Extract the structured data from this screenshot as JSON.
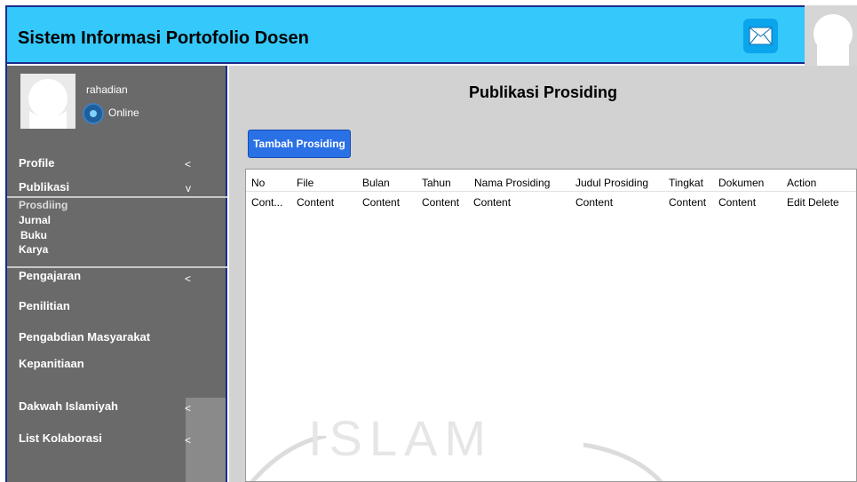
{
  "header": {
    "title": "Sistem Informasi Portofolio Dosen"
  },
  "user": {
    "name": "rahadian",
    "status": "Online"
  },
  "sidebar": {
    "profile": {
      "label": "Profile",
      "arrow": "<"
    },
    "publikasi": {
      "label": "Publikasi",
      "arrow": "v"
    },
    "sub": [
      "Prosdiing",
      "Jurnal",
      "Buku",
      "Karya"
    ],
    "pengajaran": {
      "label": "Pengajaran",
      "arrow": "<"
    },
    "penilitian": {
      "label": "Penilitian"
    },
    "pengabdian": {
      "label": "Pengabdian Masyarakat"
    },
    "kepanitiaan": {
      "label": "Kepanitiaan"
    },
    "dakwah": {
      "label": "Dakwah Islamiyah",
      "arrow": "<"
    },
    "kolaborasi": {
      "label": "List Kolaborasi",
      "arrow": "<"
    }
  },
  "main": {
    "title": "Publikasi Prosiding",
    "add_button": "Tambah Prosiding",
    "columns": [
      "No",
      "File",
      "Bulan",
      "Tahun",
      "Nama Prosiding",
      "Judul Prosiding",
      "Tingkat",
      "Dokumen",
      "Action"
    ],
    "row": [
      "Cont...",
      "Content",
      "Content",
      "Content",
      "Content",
      "Content",
      "Content",
      "Content",
      "Edit Delete"
    ],
    "watermark": "ISLAM"
  },
  "colors": {
    "header_bg": "#35c8fa",
    "sidebar_bg": "#6a6a6a",
    "button_bg": "#2a71e6"
  },
  "icons": {
    "mail": "mail-icon",
    "avatar": "avatar-icon",
    "online": "online-status-icon"
  }
}
